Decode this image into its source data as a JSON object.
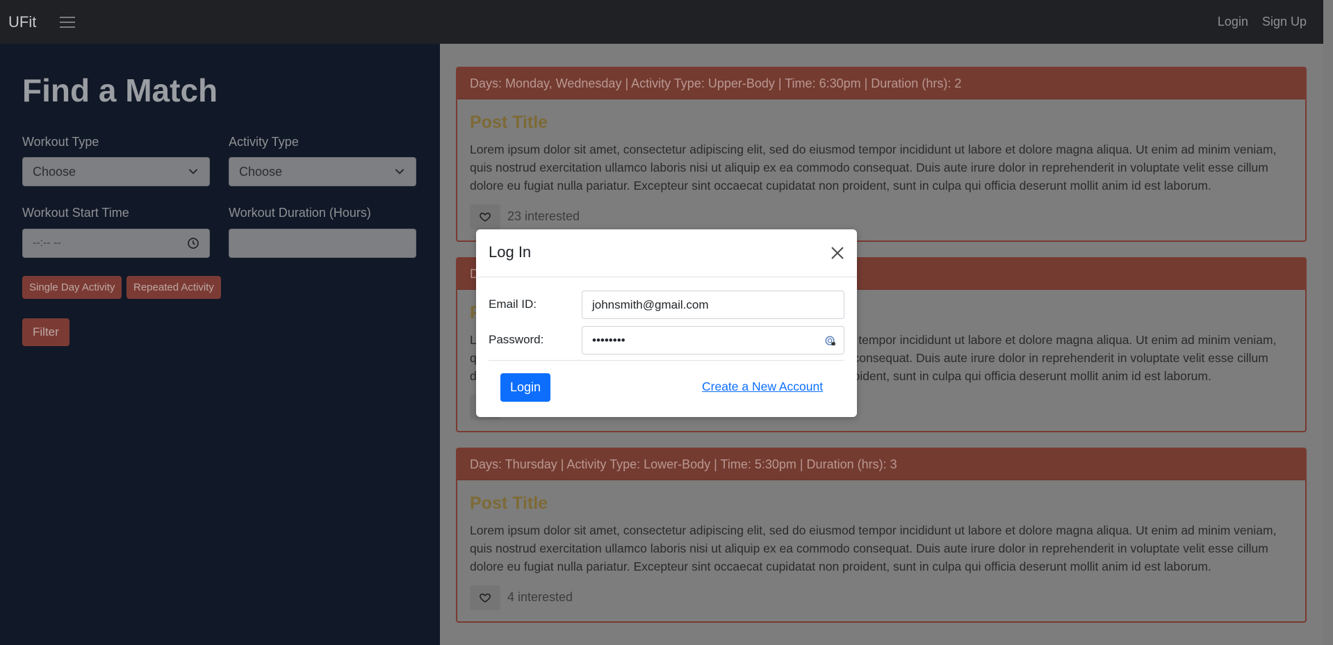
{
  "navbar": {
    "brand": "UFit",
    "login": "Login",
    "signup": "Sign Up"
  },
  "sidebar": {
    "title": "Find a Match",
    "workout_type_label": "Workout Type",
    "workout_type_value": "Choose",
    "activity_type_label": "Activity Type",
    "activity_type_value": "Choose",
    "start_time_label": "Workout Start Time",
    "start_time_placeholder": "--:-- --",
    "duration_label": "Workout Duration (Hours)",
    "duration_value": "",
    "single_day_btn": "Single Day Activity",
    "repeated_btn": "Repeated Activity",
    "filter_btn": "Filter"
  },
  "posts": [
    {
      "header": "Days: Monday, Wednesday | Activity Type: Upper-Body | Time: 6:30pm | Duration (hrs): 2",
      "title": "Post Title",
      "body": "Lorem ipsum dolor sit amet, consectetur adipiscing elit, sed do eiusmod tempor incididunt ut labore et dolore magna aliqua. Ut enim ad minim veniam, quis nostrud exercitation ullamco laboris nisi ut aliquip ex ea commodo consequat. Duis aute irure dolor in reprehenderit in voluptate velit esse cillum dolore eu fugiat nulla pariatur. Excepteur sint occaecat cupidatat non proident, sunt in culpa qui officia deserunt mollit anim id est laborum.",
      "interested": "23 interested"
    },
    {
      "header": "D",
      "title": "P",
      "body": "Lorem ipsum dolor sit amet, consectetur adipiscing elit, sed do eiusmod tempor incididunt ut labore et dolore magna aliqua. Ut enim ad minim veniam, quis nostrud exercitation ullamco laboris nisi ut aliquip ex ea commodo consequat. Duis aute irure dolor in reprehenderit in voluptate velit esse cillum dolore eu fugiat nulla pariatur. Excepteur sint occaecat cupidatat non proident, sunt in culpa qui officia deserunt mollit anim id est laborum.",
      "interested": ""
    },
    {
      "header": "Days: Thursday | Activity Type: Lower-Body | Time: 5:30pm | Duration (hrs): 3",
      "title": "Post Title",
      "body": "Lorem ipsum dolor sit amet, consectetur adipiscing elit, sed do eiusmod tempor incididunt ut labore et dolore magna aliqua. Ut enim ad minim veniam, quis nostrud exercitation ullamco laboris nisi ut aliquip ex ea commodo consequat. Duis aute irure dolor in reprehenderit in voluptate velit esse cillum dolore eu fugiat nulla pariatur. Excepteur sint occaecat cupidatat non proident, sunt in culpa qui officia deserunt mollit anim id est laborum.",
      "interested": "4 interested"
    }
  ],
  "modal": {
    "title": "Log In",
    "email_label": "Email ID:",
    "email_value": "johnsmith@gmail.com",
    "password_label": "Password:",
    "password_value": "••••••••",
    "login_btn": "Login",
    "create_link": "Create a New Account"
  },
  "colors": {
    "primary": "#0d6efd",
    "navbar": "#1f2125",
    "sidebar": "#111827",
    "accent": "#b94a3b"
  }
}
